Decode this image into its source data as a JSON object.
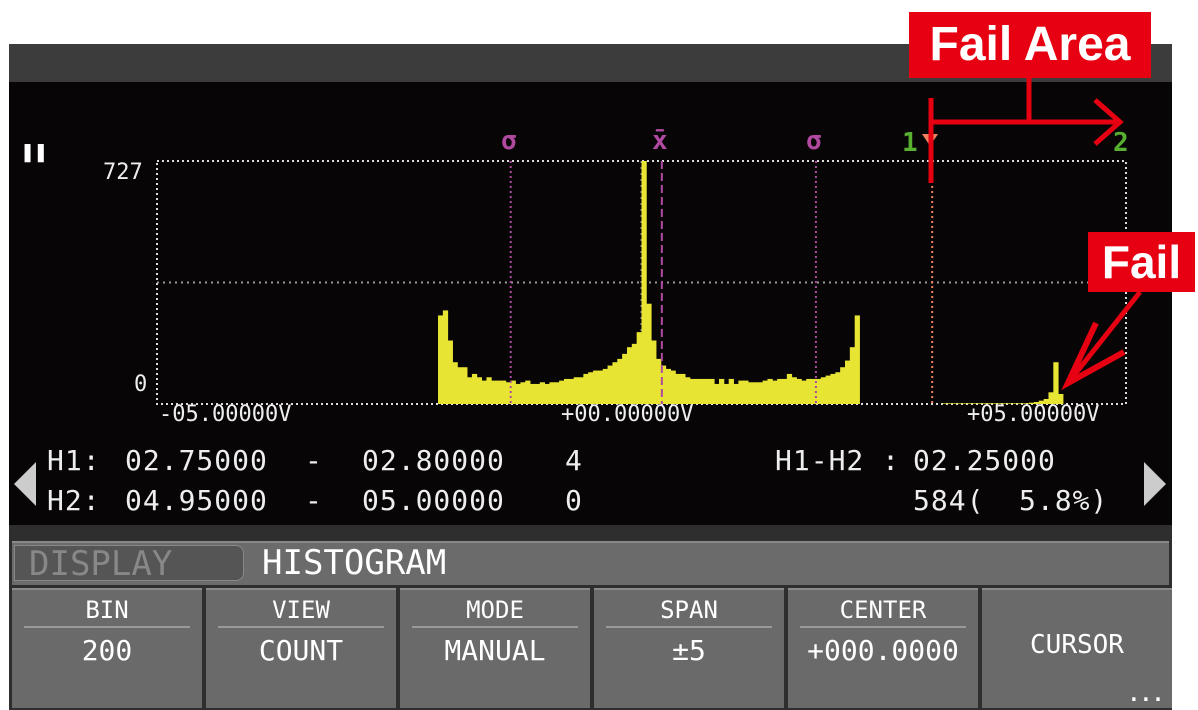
{
  "status": {
    "pause_icon": "pause-icon"
  },
  "histogram": {
    "y_max_label": "727",
    "y_min_label": "0",
    "x_labels": [
      "-05.00000V",
      "+00.00000V",
      "+05.00000V"
    ],
    "markers": {
      "sigma_left": "σ",
      "mean": "x̄",
      "sigma_right": "σ",
      "cursor1": "1",
      "cursor2": "2"
    },
    "colors": {
      "bars": "#e8e433",
      "sigma": "#b04aa0",
      "cursor": "#57b030",
      "cursor1_line": "#f08060"
    }
  },
  "chart_data": {
    "type": "bar",
    "xlim": [
      -5,
      5
    ],
    "ylim": [
      0,
      727
    ],
    "grid": true,
    "bins": 200,
    "bin_start": -2.1,
    "bin_width": 0.05,
    "counts": [
      265,
      280,
      190,
      125,
      110,
      110,
      80,
      90,
      80,
      70,
      80,
      70,
      70,
      70,
      65,
      70,
      60,
      65,
      70,
      60,
      60,
      65,
      60,
      65,
      65,
      70,
      75,
      75,
      80,
      80,
      90,
      95,
      100,
      100,
      105,
      115,
      125,
      135,
      150,
      170,
      180,
      215,
      727,
      300,
      190,
      135,
      115,
      105,
      100,
      90,
      90,
      80,
      75,
      75,
      75,
      75,
      75,
      60,
      75,
      60,
      75,
      60,
      70,
      70,
      65,
      65,
      65,
      70,
      75,
      70,
      75,
      75,
      90,
      80,
      75,
      70,
      75,
      75,
      75,
      80,
      85,
      90,
      95,
      110,
      130,
      170,
      265,
      0,
      0,
      0,
      0,
      0,
      0,
      0,
      0,
      0,
      0,
      0,
      0,
      0,
      0,
      0,
      0,
      0,
      2,
      2,
      2,
      2,
      2,
      2,
      2,
      2,
      2,
      2,
      2,
      2,
      2,
      2,
      2,
      2,
      2,
      2,
      4,
      6,
      10,
      15,
      35,
      125,
      30
    ],
    "markers_v": {
      "sigma_left": -1.35,
      "mean": 0.21,
      "sigma_right": 1.8,
      "cursor1": 3.0,
      "cursor2": 5.0
    }
  },
  "readout": {
    "h1": {
      "label": "H1:",
      "from": "02.75000",
      "dash": "-",
      "to": "02.80000",
      "count": "4"
    },
    "h2": {
      "label": "H2:",
      "from": "04.95000",
      "dash": "-",
      "to": "05.00000",
      "count": "0"
    },
    "diff_label": "H1-H2 :",
    "diff_value": "02.25000",
    "total": "584(",
    "percent": "5.8%)"
  },
  "tabs": {
    "display": "DISPLAY",
    "histogram": "HISTOGRAM"
  },
  "softkeys": [
    {
      "label": "BIN",
      "value": "200"
    },
    {
      "label": "VIEW",
      "value": "COUNT"
    },
    {
      "label": "MODE",
      "value": "MANUAL"
    },
    {
      "label": "SPAN",
      "value": "±5"
    },
    {
      "label": "CENTER",
      "value": "+000.0000"
    },
    {
      "label": "CURSOR",
      "more": "..."
    }
  ],
  "annotations": {
    "fail_area": "Fail Area",
    "fail": "Fail",
    "color": "#e60012"
  }
}
